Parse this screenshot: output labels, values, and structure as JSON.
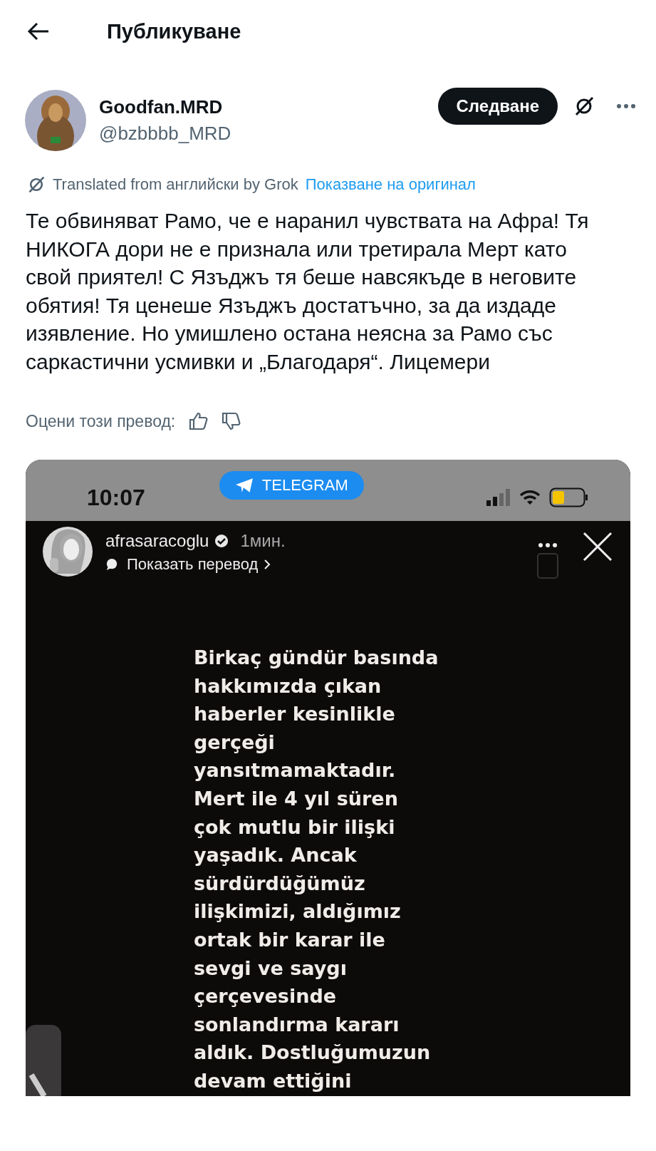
{
  "header": {
    "title": "Публикуване"
  },
  "author": {
    "name": "Goodfan.MRD",
    "handle": "@bzbbbb_MRD"
  },
  "follow_button": {
    "label": "Следване"
  },
  "translation": {
    "note": "Translated from английски by Grok",
    "link": "Показване на оригинал"
  },
  "text": "Те обвиняват Рамо, че е наранил чувствата на Афра! Тя НИКОГА дори не е признала или третирала Мерт като свой приятел! С Язъджъ тя беше навсякъде в неговите обятия! Тя ценеше Язъджъ достатъчно, за да издаде изявление. Но умишлено остана неясна за Рамо със саркастични усмивки и „Благодаря“. Лицемери",
  "rating": {
    "label": "Оцени този превод:"
  },
  "media": {
    "status_bar": {
      "time": "10:07",
      "pill": "TELEGRAM"
    },
    "story": {
      "username": "afrasaracoglu",
      "age": "1мин.",
      "translate": "Показать перевод",
      "lines": [
        "Birkaç gündür basında",
        "hakkımızda çıkan",
        "haberler kesinlikle",
        "gerçeği",
        "yansıtmamaktadır.",
        "Mert ile 4 yıl süren",
        "çok mutlu bir ilişki",
        "yaşadık. Ancak",
        "sürdürdüğümüz",
        "ilişkimizi, aldığımız",
        "ortak bir karar ile",
        "sevgi ve saygı",
        "çerçevesinde",
        "sonlandırma kararı",
        "aldık. Dostluğumuzun",
        "devam ettiğini"
      ]
    }
  }
}
